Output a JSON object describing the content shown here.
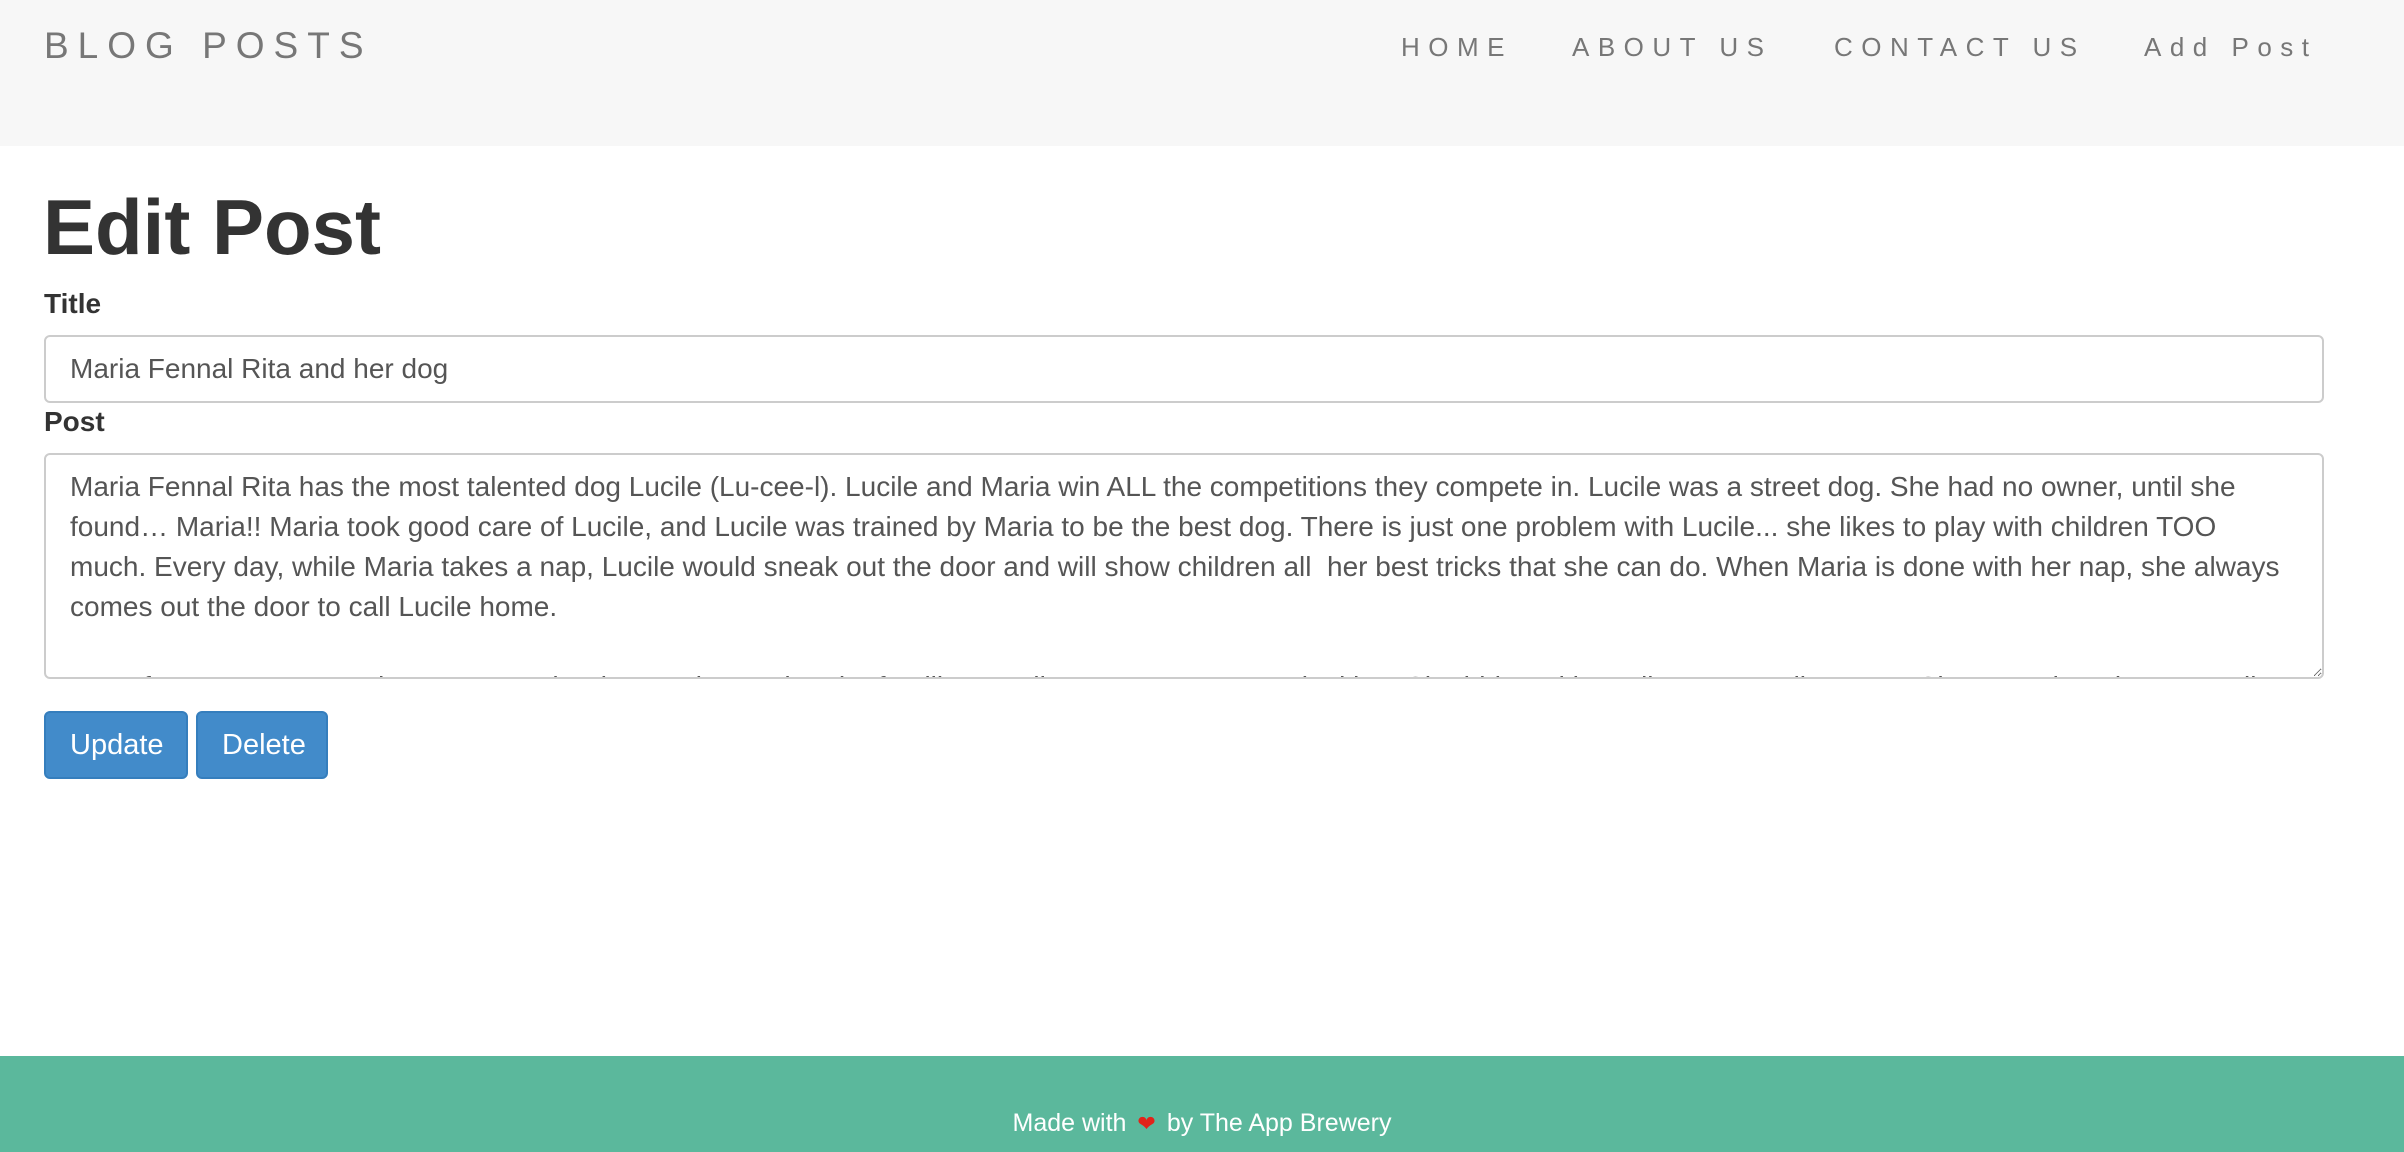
{
  "header": {
    "brand": "BLOG POSTS",
    "nav": [
      {
        "label": "HOME"
      },
      {
        "label": "ABOUT US"
      },
      {
        "label": "CONTACT US"
      },
      {
        "label": "Add Post"
      }
    ]
  },
  "main": {
    "title": "Edit Post",
    "title_label": "Title",
    "title_value": "Maria Fennal Rita and her dog",
    "post_label": "Post",
    "post_value": "Maria Fennal Rita has the most talented dog Lucile (Lu-cee-l). Lucile and Maria win ALL the competitions they compete in. Lucile was a street dog. She had no owner, until she found… Maria!! Maria took good care of Lucile, and Lucile was trained by Maria to be the best dog. There is just one problem with Lucile... she likes to play with children TOO much. Every day, while Maria takes a nap, Lucile would sneak out the door and will show children all  her best tricks that she can do. When Maria is done with her nap, she always comes out the door to call Lucile home.\n\n       After every nap, Maria comes out the door and sees that the families, Lucile's new owners, are looking. She hides with Lucile. Now Lucile can't... She starts learning. Her tail...",
    "update_label": "Update",
    "delete_label": "Delete"
  },
  "footer": {
    "text_before": "Made with",
    "heart_icon": "heart-icon",
    "heart_color": "#e2231a",
    "text_after": "by The App Brewery"
  },
  "colors": {
    "navbar_bg": "#f7f7f7",
    "button": "#428bca",
    "footer_bg": "#5bb89c"
  }
}
